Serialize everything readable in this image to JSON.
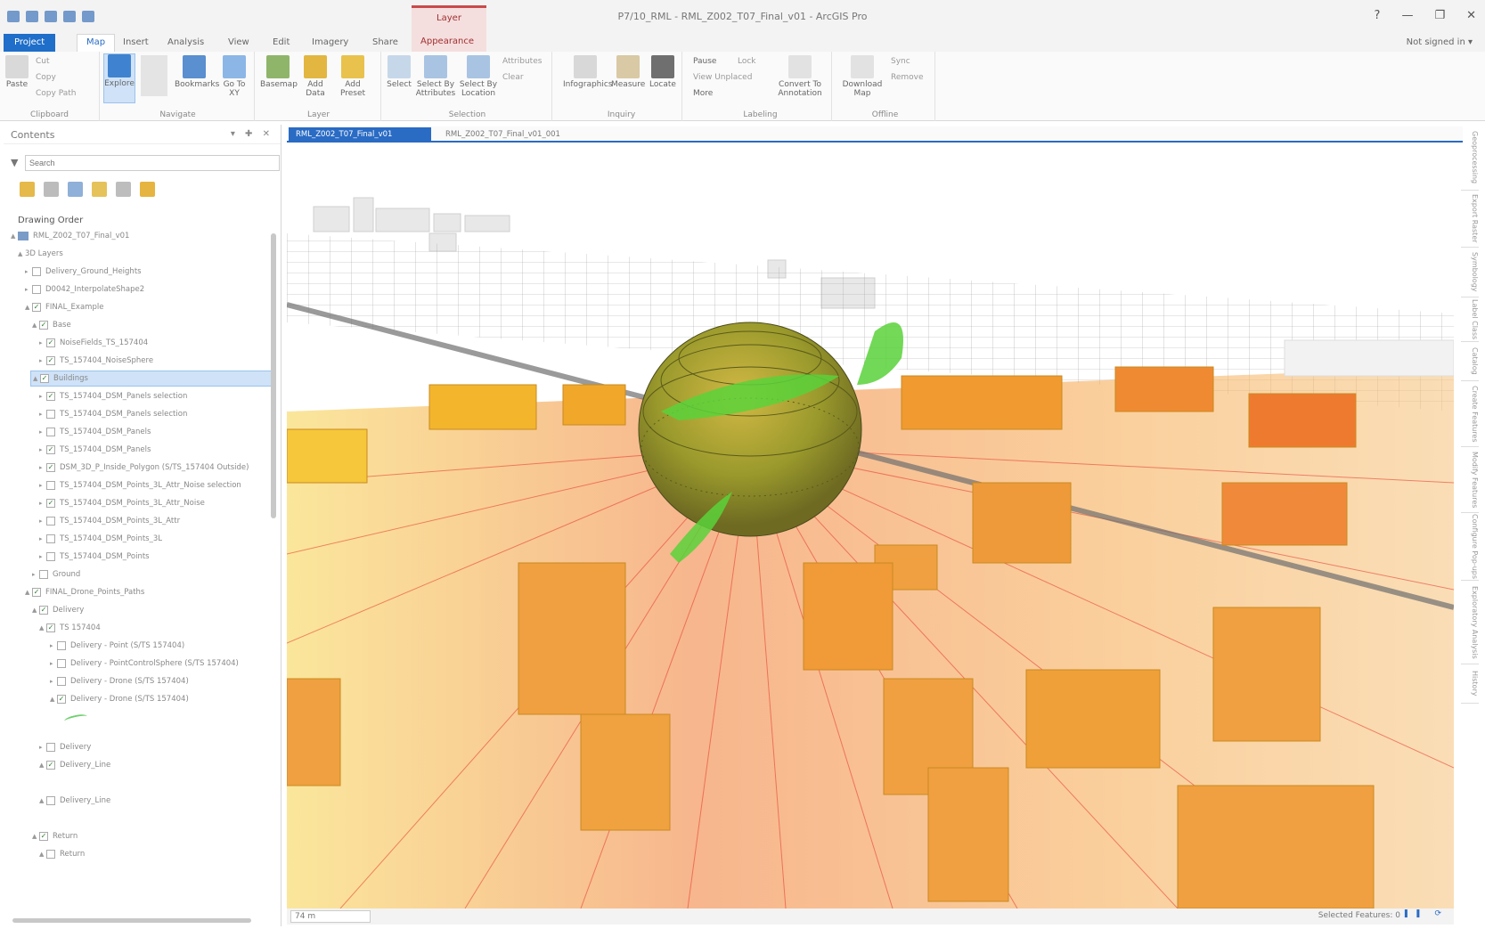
{
  "window": {
    "title": "P7/10_RML - RML_Z002_T07_Final_v01 - ArcGIS Pro",
    "contextual_group": "Layer",
    "help": "?",
    "minimize": "—",
    "restore": "❐",
    "close": "✕"
  },
  "ribbon_tabs": [
    "Project",
    "Map",
    "Insert",
    "Analysis",
    "View",
    "Edit",
    "Imagery",
    "Share",
    "Appearance"
  ],
  "signin": "Not signed in ▾",
  "ribbon": {
    "clipboard": {
      "label": "Clipboard",
      "paste": "Paste",
      "cut": "Cut",
      "copy": "Copy",
      "copy_path": "Copy Path"
    },
    "navigate": {
      "label": "Navigate",
      "explore": "Explore",
      "bookmarks": "Bookmarks",
      "go_to_xy": "Go To XY"
    },
    "layer": {
      "label": "Layer",
      "basemap": "Basemap",
      "add_data": "Add Data",
      "add_preset": "Add Preset"
    },
    "selection": {
      "label": "Selection",
      "select": "Select",
      "select_by_attributes": "Select By Attributes",
      "select_by_location": "Select By Location",
      "attributes": "Attributes",
      "clear": "Clear"
    },
    "inquiry": {
      "label": "Inquiry",
      "infographics": "Infographics",
      "measure": "Measure",
      "locate": "Locate"
    },
    "labeling": {
      "label": "Labeling",
      "pause": "Pause",
      "lock": "Lock",
      "view_unplaced": "View Unplaced",
      "more": "More",
      "convert_to_annotation": "Convert To Annotation"
    },
    "offline": {
      "label": "Offline",
      "download_map": "Download Map",
      "sync": "Sync",
      "remove": "Remove"
    }
  },
  "contents": {
    "title": "Contents",
    "search_placeholder": "Search",
    "drawing_order": "Drawing Order",
    "items": [
      {
        "label": "RML_Z002_T07_Final_v01",
        "checked": false
      },
      {
        "label": "3D Layers",
        "checked": false
      },
      {
        "label": "Delivery_Ground_Heights",
        "checked": false
      },
      {
        "label": "D0042_InterpolateShape2",
        "checked": false
      },
      {
        "label": "FINAL_Example",
        "checked": true
      },
      {
        "label": "Base",
        "checked": true
      },
      {
        "label": "NoiseFields_TS_157404",
        "checked": true
      },
      {
        "label": "TS_157404_NoiseSphere",
        "checked": true
      },
      {
        "label": "Buildings",
        "checked": true
      },
      {
        "label": "TS_157404_DSM_Panels selection",
        "checked": true
      },
      {
        "label": "TS_157404_DSM_Panels selection",
        "checked": false
      },
      {
        "label": "TS_157404_DSM_Panels",
        "checked": false
      },
      {
        "label": "TS_157404_DSM_Panels",
        "checked": true
      },
      {
        "label": "DSM_3D_P_Inside_Polygon (S/TS_157404 Outside)",
        "checked": true
      },
      {
        "label": "TS_157404_DSM_Points_3L_Attr_Noise selection",
        "checked": false
      },
      {
        "label": "TS_157404_DSM_Points_3L_Attr_Noise",
        "checked": true
      },
      {
        "label": "TS_157404_DSM_Points_3L_Attr",
        "checked": false
      },
      {
        "label": "TS_157404_DSM_Points_3L",
        "checked": false
      },
      {
        "label": "TS_157404_DSM_Points",
        "checked": false
      },
      {
        "label": "Ground",
        "checked": false
      },
      {
        "label": "FINAL_Drone_Points_Paths",
        "checked": true
      },
      {
        "label": "Delivery",
        "checked": true
      },
      {
        "label": "TS 157404",
        "checked": true
      },
      {
        "label": "Delivery - Point (S/TS 157404)",
        "checked": false
      },
      {
        "label": "Delivery - PointControlSphere (S/TS 157404)",
        "checked": false
      },
      {
        "label": "Delivery - Drone (S/TS 157404)",
        "checked": false
      },
      {
        "label": "Delivery - Drone (S/TS 157404)",
        "checked": true
      },
      {
        "label": "Delivery",
        "checked": false
      },
      {
        "label": "Delivery_Line",
        "checked": true
      },
      {
        "label": "Delivery_Line",
        "checked": false
      },
      {
        "label": "Return",
        "checked": true
      },
      {
        "label": "Return",
        "checked": false
      }
    ]
  },
  "map_tabs": [
    "RML_Z002_T07_Final_v01",
    "RML_Z002_T07_Final_v01_001"
  ],
  "status": {
    "scale": "74 m",
    "selected": "Selected Features: 0"
  },
  "side_panels": [
    "Geoprocessing",
    "Export Raster",
    "Symbology",
    "Label Class",
    "Catalog",
    "Create Features",
    "Modify Features",
    "Configure Pop-ups",
    "Exploratory Analysis",
    "History"
  ],
  "colors": {
    "accent": "#2a6bc4",
    "project_tab": "#1f6ec9",
    "contextual": "#c94a4a",
    "selection": "#cfe2f7"
  }
}
